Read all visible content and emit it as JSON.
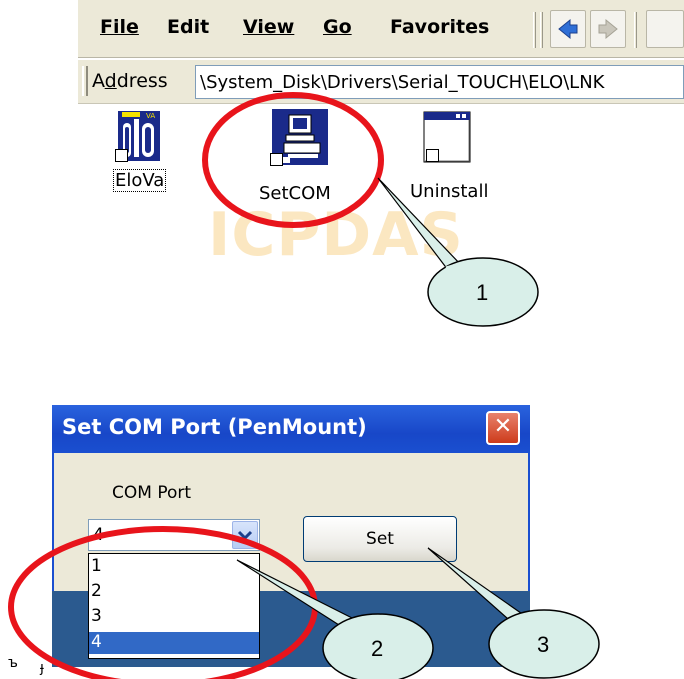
{
  "explorer": {
    "menu": [
      {
        "label": "File"
      },
      {
        "label": "Edit"
      },
      {
        "label": "View"
      },
      {
        "label": "Go"
      },
      {
        "label": "Favorites"
      }
    ],
    "address_label": "Address",
    "address_value": "\\System_Disk\\Drivers\\Serial_TOUCH\\ELO\\LNK",
    "watermark": "ICPDAS",
    "icons": [
      {
        "label": "EloVa",
        "icon": "elova-app-icon"
      },
      {
        "label": "SetCOM",
        "icon": "setcom-computer-icon"
      },
      {
        "label": "Uninstall",
        "icon": "window-icon"
      }
    ]
  },
  "dialog": {
    "title": "Set COM Port (PenMount)",
    "close_glyph": "✕",
    "com_port_label": "COM Port",
    "selected_value": "4",
    "options": [
      "1",
      "2",
      "3",
      "4"
    ],
    "selected_option": "4",
    "set_button": "Set"
  },
  "callouts": {
    "one": "1",
    "two": "2",
    "three": "3"
  },
  "colors": {
    "annotation_red": "#e8141b",
    "callout_fill": "#d9efe9",
    "titlebar_blue": "#1a4fd0"
  }
}
